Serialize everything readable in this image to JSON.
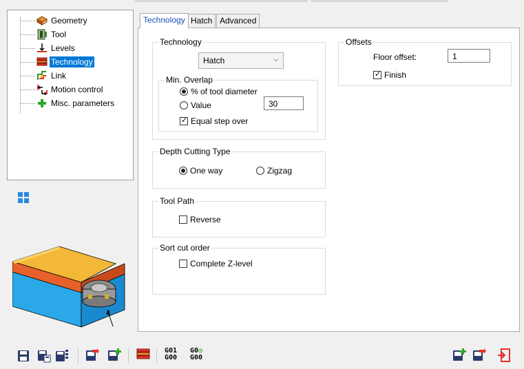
{
  "tree": {
    "items": [
      {
        "label": "Geometry",
        "icon": "geometry-icon"
      },
      {
        "label": "Tool",
        "icon": "tool-icon"
      },
      {
        "label": "Levels",
        "icon": "levels-icon"
      },
      {
        "label": "Technology",
        "icon": "technology-icon",
        "selected": true
      },
      {
        "label": "Link",
        "icon": "link-icon"
      },
      {
        "label": "Motion control",
        "icon": "motion-control-icon"
      },
      {
        "label": "Misc. parameters",
        "icon": "misc-parameters-icon"
      }
    ]
  },
  "tabs": [
    {
      "label": "Technology",
      "active": true
    },
    {
      "label": "Hatch"
    },
    {
      "label": "Advanced"
    }
  ],
  "technology_group": {
    "title": "Technology",
    "combo_value": "Hatch",
    "min_overlap": {
      "title": "Min. Overlap",
      "option_percent": "% of tool diameter",
      "option_value": "Value",
      "value": "30",
      "equal_step_over": "Equal step over"
    }
  },
  "depth_group": {
    "title": "Depth Cutting Type",
    "one_way": "One way",
    "zigzag": "Zigzag"
  },
  "toolpath_group": {
    "title": "Tool Path",
    "reverse": "Reverse"
  },
  "sort_group": {
    "title": "Sort cut order",
    "complete_z": "Complete Z-level"
  },
  "offsets_group": {
    "title": "Offsets",
    "floor_offset_label": "Floor offset:",
    "floor_offset_value": "1",
    "finish": "Finish"
  },
  "toolbar": {
    "gcode1_top": "G01",
    "gcode1_bottom": "G00",
    "gcode2_top": "G0",
    "gcode2_bottom": "G00"
  },
  "colors": {
    "selection": "#0078d7",
    "tab_active_text": "#1a4fb5"
  }
}
